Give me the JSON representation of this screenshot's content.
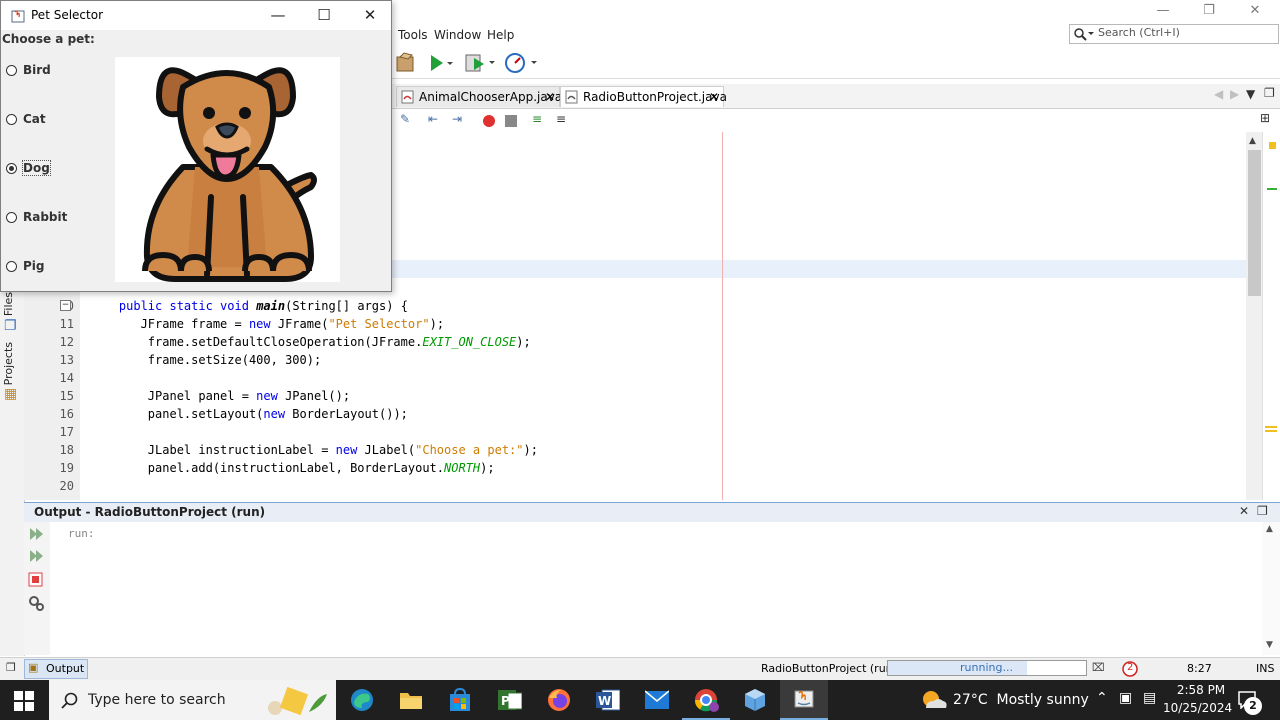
{
  "ide": {
    "menu": [
      "Tools",
      "Window",
      "Help"
    ],
    "search_placeholder": "Search (Ctrl+I)",
    "tabs": [
      {
        "label": "AnimalChooserApp.java",
        "active": false
      },
      {
        "label": "RadioButtonProject.java",
        "active": true
      }
    ],
    "code_lines": [
      {
        "num": "10",
        "tokens": [
          [
            "",
            "    "
          ],
          [
            "kw",
            "public static void "
          ],
          [
            "mth",
            "main"
          ],
          [
            "",
            "(String[] args) {"
          ]
        ]
      },
      {
        "num": "11",
        "tokens": [
          [
            "",
            "       JFrame frame = "
          ],
          [
            "kw",
            "new "
          ],
          [
            "",
            "JFrame("
          ],
          [
            "str",
            "\"Pet Selector\""
          ],
          [
            "",
            ");"
          ]
        ]
      },
      {
        "num": "12",
        "tokens": [
          [
            "",
            "        frame.setDefaultCloseOperation(JFrame."
          ],
          [
            "cst",
            "EXIT_ON_CLOSE"
          ],
          [
            "",
            ");"
          ]
        ]
      },
      {
        "num": "13",
        "tokens": [
          [
            "",
            "        frame.setSize(400, 300);"
          ]
        ]
      },
      {
        "num": "14",
        "tokens": [
          [
            "",
            ""
          ]
        ]
      },
      {
        "num": "15",
        "tokens": [
          [
            "",
            "        JPanel panel = "
          ],
          [
            "kw",
            "new "
          ],
          [
            "",
            "JPanel();"
          ]
        ]
      },
      {
        "num": "16",
        "tokens": [
          [
            "",
            "        panel.setLayout("
          ],
          [
            "kw",
            "new "
          ],
          [
            "",
            "BorderLayout());"
          ]
        ]
      },
      {
        "num": "17",
        "tokens": [
          [
            "",
            ""
          ]
        ]
      },
      {
        "num": "18",
        "tokens": [
          [
            "",
            "        JLabel instructionLabel = "
          ],
          [
            "kw",
            "new "
          ],
          [
            "",
            "JLabel("
          ],
          [
            "str",
            "\"Choose a pet:\""
          ],
          [
            "",
            ");"
          ]
        ]
      },
      {
        "num": "19",
        "tokens": [
          [
            "",
            "        panel.add(instructionLabel, BorderLayout."
          ],
          [
            "cst",
            "NORTH"
          ],
          [
            "",
            ");"
          ]
        ]
      },
      {
        "num": "20",
        "tokens": [
          [
            "",
            ""
          ]
        ]
      }
    ],
    "left_tabs": [
      "Files",
      "Projects"
    ],
    "output": {
      "title": "Output - RadioButtonProject (run)",
      "text": "run:"
    },
    "status": {
      "output_tab": "Output",
      "project": "RadioButtonProject (run)",
      "progress_label": "running...",
      "progress_fraction": 0.7,
      "error_count": "2",
      "position": "8:27",
      "mode": "INS"
    }
  },
  "pet_window": {
    "title": "Pet Selector",
    "instruction": "Choose a pet:",
    "options": [
      {
        "label": "Bird",
        "selected": false
      },
      {
        "label": "Cat",
        "selected": false
      },
      {
        "label": "Dog",
        "selected": true
      },
      {
        "label": "Rabbit",
        "selected": false
      },
      {
        "label": "Pig",
        "selected": false
      }
    ]
  },
  "taskbar": {
    "search_placeholder": "Type here to search",
    "weather": "27°C  Mostly sunny",
    "time": "2:58 PM",
    "date": "10/25/2024",
    "notification_count": "2"
  }
}
